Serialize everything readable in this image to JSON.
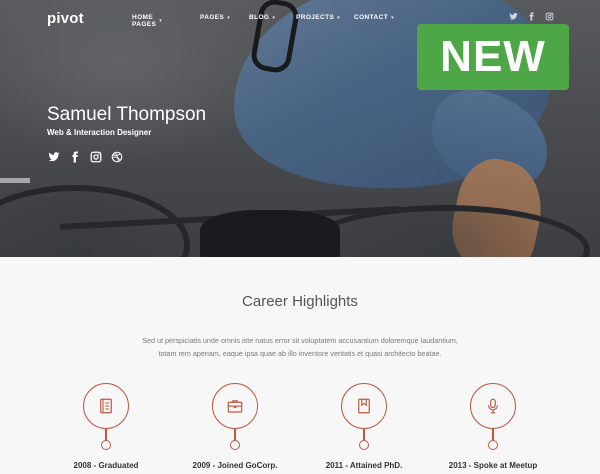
{
  "brand": {
    "logo": "pivot"
  },
  "nav": {
    "items": [
      {
        "label": "HOME PAGES",
        "has_dropdown": true
      },
      {
        "label": "PAGES",
        "has_dropdown": true
      },
      {
        "label": "BLOG",
        "has_dropdown": true
      },
      {
        "label": "PROJECTS",
        "has_dropdown": true
      },
      {
        "label": "CONTACT",
        "has_dropdown": true
      }
    ],
    "social_icons": [
      "twitter-icon",
      "facebook-icon",
      "instagram-icon"
    ]
  },
  "badge": {
    "label": "NEW",
    "color": "#4ea746"
  },
  "hero": {
    "name": "Samuel Thompson",
    "role": "Web & Interaction Designer",
    "social_icons": [
      "twitter-icon",
      "facebook-icon",
      "instagram-icon",
      "dribbble-icon"
    ]
  },
  "career": {
    "title": "Career Highlights",
    "description_line1": "Sed ut perspiciatis unde omnis iste natus error sit voluptatem accusantium doloremque laudantium,",
    "description_line2": "totam rem aperiam, eaque ipsa quae ab illo inventore veritatis et quasi architecto beatae.",
    "accent_color": "#c0573f",
    "items": [
      {
        "label": "2008 - Graduated",
        "icon": "notebook-icon"
      },
      {
        "label": "2009 - Joined GoCorp.",
        "icon": "briefcase-icon"
      },
      {
        "label": "2011 - Attained PhD.",
        "icon": "bookmark-icon"
      },
      {
        "label": "2013 - Spoke at Meetup",
        "icon": "microphone-icon"
      }
    ]
  }
}
